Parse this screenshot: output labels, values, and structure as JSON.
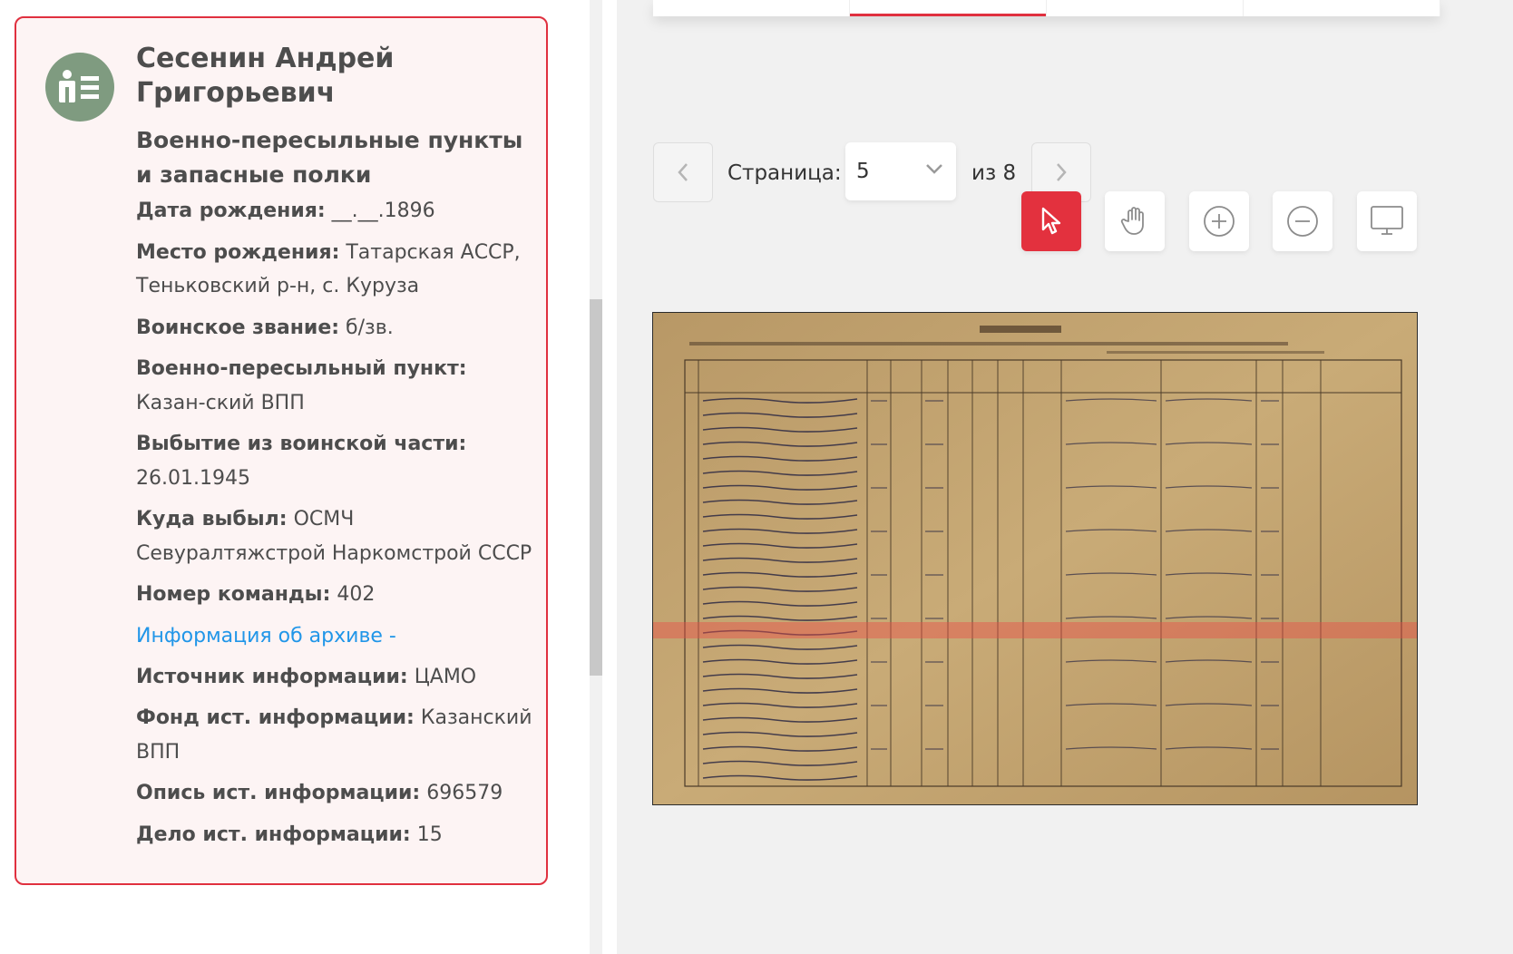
{
  "person": {
    "name": "Сесенин Андрей Григорьевич",
    "category": "Военно-пересыльные пункты и запасные полки",
    "fields": [
      {
        "label": "Дата рождения:",
        "value": " __.__.1896"
      },
      {
        "label": "Место рождения:",
        "value": " Татарская АССР, Теньковский р-н, с. Куруза"
      },
      {
        "label": "Воинское звание:",
        "value": " б/зв."
      },
      {
        "label": "Военно-пересыльный пункт:",
        "value": " Казан-ский ВПП"
      },
      {
        "label": "Выбытие из воинской части:",
        "value": " 26.01.1945"
      },
      {
        "label": "Куда выбыл:",
        "value": " ОСМЧ Севуралтяжстрой Наркомстрой СССР"
      },
      {
        "label": "Номер команды:",
        "value": " 402"
      }
    ],
    "archive_link": "Информация об архиве -",
    "archive_fields": [
      {
        "label": "Источник информации:",
        "value": " ЦАМО"
      },
      {
        "label": "Фонд ист. информации:",
        "value": " Казанский ВПП"
      },
      {
        "label": "Опись ист. информации:",
        "value": " 696579"
      },
      {
        "label": "Дело ист. информации:",
        "value": " 15"
      }
    ]
  },
  "viewer": {
    "page_label": "Страница:",
    "page_value": "5",
    "page_total": "из 8"
  },
  "colors": {
    "accent": "#e3313e",
    "link": "#2196e8",
    "avatar": "#7f9b80"
  },
  "icons": [
    "user-card-icon",
    "chevron-left-icon",
    "chevron-right-icon",
    "chevron-down-icon",
    "cursor-icon",
    "hand-icon",
    "zoom-in-icon",
    "zoom-out-icon",
    "monitor-icon"
  ]
}
